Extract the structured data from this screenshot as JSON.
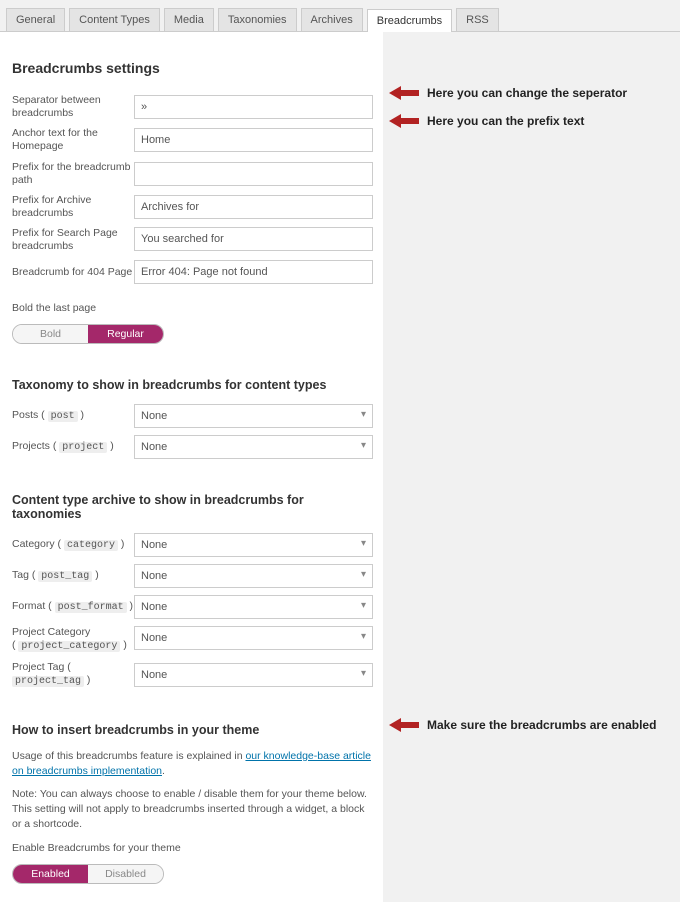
{
  "tabs": {
    "general": "General",
    "content_types": "Content Types",
    "media": "Media",
    "taxonomies": "Taxonomies",
    "archives": "Archives",
    "breadcrumbs": "Breadcrumbs",
    "rss": "RSS"
  },
  "panel": {
    "heading": "Breadcrumbs settings",
    "fields": {
      "separator": {
        "label": "Separator between breadcrumbs",
        "value": "»"
      },
      "anchor": {
        "label": "Anchor text for the Homepage",
        "value": "Home"
      },
      "prefix_path": {
        "label": "Prefix for the breadcrumb path",
        "value": ""
      },
      "prefix_archive": {
        "label": "Prefix for Archive breadcrumbs",
        "value": "Archives for"
      },
      "prefix_search": {
        "label": "Prefix for Search Page breadcrumbs",
        "value": "You searched for"
      },
      "crumb_404": {
        "label": "Breadcrumb for 404 Page",
        "value": "Error 404: Page not found"
      }
    },
    "bold_section": {
      "label": "Bold the last page",
      "options": {
        "bold": "Bold",
        "regular": "Regular"
      }
    },
    "tax_section": {
      "heading": "Taxonomy to show in breadcrumbs for content types",
      "rows": {
        "posts": {
          "label": "Posts",
          "slug": "post",
          "value": "None"
        },
        "projects": {
          "label": "Projects",
          "slug": "project",
          "value": "None"
        }
      }
    },
    "cta_section": {
      "heading": "Content type archive to show in breadcrumbs for taxonomies",
      "rows": {
        "category": {
          "label": "Category",
          "slug": "category",
          "value": "None"
        },
        "tag": {
          "label": "Tag",
          "slug": "post_tag",
          "value": "None"
        },
        "format": {
          "label": "Format",
          "slug": "post_format",
          "value": "None"
        },
        "proj_cat": {
          "label": "Project Category",
          "slug": "project_category",
          "value": "None"
        },
        "proj_tag": {
          "label": "Project Tag",
          "slug": "project_tag",
          "value": "None"
        }
      }
    },
    "insert_section": {
      "heading": "How to insert breadcrumbs in your theme",
      "text1a": "Usage of this breadcrumbs feature is explained in ",
      "link": "our knowledge-base article on breadcrumbs implementation",
      "text1b": ".",
      "text2": "Note: You can always choose to enable / disable them for your theme below. This setting will not apply to breadcrumbs inserted through a widget, a block or a shortcode.",
      "enable_label": "Enable Breadcrumbs for your theme",
      "options": {
        "enabled": "Enabled",
        "disabled": "Disabled"
      }
    }
  },
  "annotations": {
    "sep": "Here you can change the seperator",
    "prefix": "Here you can the prefix text",
    "enable": "Make sure the breadcrumbs are enabled"
  }
}
